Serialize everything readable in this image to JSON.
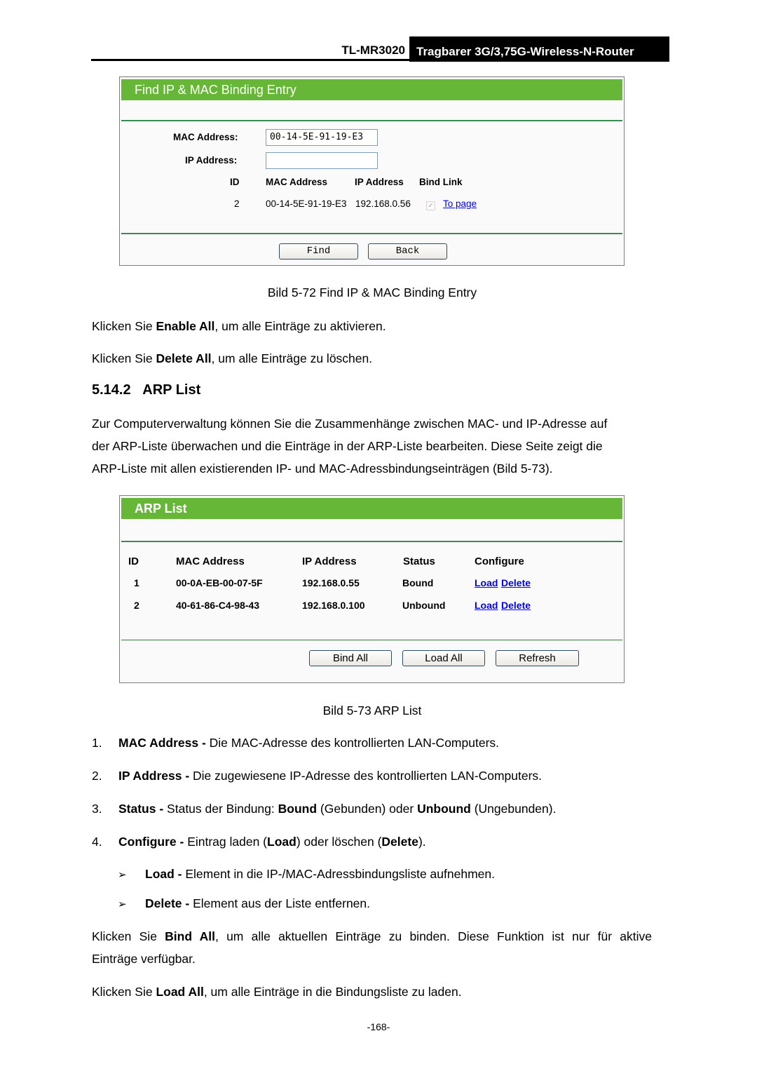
{
  "header": {
    "model": "TL-MR3020",
    "product": "Tragbarer 3G/3,75G-Wireless-N-Router"
  },
  "find_panel": {
    "title": "Find IP & MAC Binding Entry",
    "mac_label": "MAC Address:",
    "mac_value": "00-14-5E-91-19-E3",
    "ip_label": "IP Address:",
    "ip_value": "",
    "columns": [
      "ID",
      "MAC Address",
      "IP Address",
      "Bind Link"
    ],
    "rows": [
      {
        "id": "2",
        "mac": "00-14-5E-91-19-E3",
        "ip": "192.168.0.56",
        "bound": true,
        "link": "To page"
      }
    ],
    "find_button": "Find",
    "back_button": "Back"
  },
  "caption1": "Bild 5-72 Find IP & MAC Binding Entry",
  "para1": {
    "pre": "Klicken Sie ",
    "bold": "Enable All",
    "post": ", um alle Einträge zu aktivieren."
  },
  "para2": {
    "pre": "Klicken Sie ",
    "bold": "Delete All",
    "post": ", um alle Einträge zu löschen."
  },
  "section": {
    "number": "5.14.2",
    "title": "ARP List"
  },
  "intro": [
    "Zur Computerverwaltung können Sie die Zusammenhänge zwischen MAC- und IP-Adresse auf",
    "der ARP-Liste überwachen und die Einträge in der ARP-Liste bearbeiten. Diese Seite zeigt die",
    "ARP-Liste mit allen existierenden IP- und MAC-Adressbindungseinträgen (Bild 5-73)."
  ],
  "arp_panel": {
    "title": "ARP List",
    "columns": [
      "ID",
      "MAC Address",
      "IP Address",
      "Status",
      "Configure"
    ],
    "rows": [
      {
        "id": "1",
        "mac": "00-0A-EB-00-07-5F",
        "ip": "192.168.0.55",
        "status": "Bound",
        "load": "Load",
        "delete": "Delete"
      },
      {
        "id": "2",
        "mac": "40-61-86-C4-98-43",
        "ip": "192.168.0.100",
        "status": "Unbound",
        "load": "Load",
        "delete": "Delete"
      }
    ],
    "buttons": [
      "Bind All",
      "Load All",
      "Refresh"
    ]
  },
  "caption2": "Bild 5-73 ARP List",
  "list": [
    {
      "num": "1.",
      "term": "MAC Address -",
      "text": " Die MAC-Adresse des kontrollierten LAN-Computers."
    },
    {
      "num": "2.",
      "term": "IP Address -",
      "text": " Die zugewiesene IP-Adresse des kontrollierten LAN-Computers."
    },
    {
      "num": "3.",
      "term": "Status -",
      "text1": " Status der Bindung: ",
      "b1": "Bound",
      "text2": " (Gebunden) oder ",
      "b2": "Unbound",
      "text3": " (Ungebunden)."
    },
    {
      "num": "4.",
      "term": "Configure -",
      "text1": " Eintrag laden (",
      "b1": "Load",
      "text2": ") oder löschen (",
      "b2": "Delete",
      "text3": ")."
    }
  ],
  "sublist": [
    {
      "bullet": "➢",
      "term": "Load -",
      "text": " Element in die IP-/MAC-Adressbindungsliste aufnehmen."
    },
    {
      "bullet": "➢",
      "term": "Delete -",
      "text": " Element aus der Liste entfernen."
    }
  ],
  "para3": {
    "pre": "Klicken Sie ",
    "bold": "Bind All",
    "post": ", um alle aktuellen Einträge zu binden. Diese Funktion ist nur für aktive",
    "line2": "Einträge verfügbar."
  },
  "para4": {
    "pre": "Klicken Sie ",
    "bold": "Load All",
    "post": ", um alle Einträge in die Bindungsliste zu laden."
  },
  "page_number": "-168-"
}
